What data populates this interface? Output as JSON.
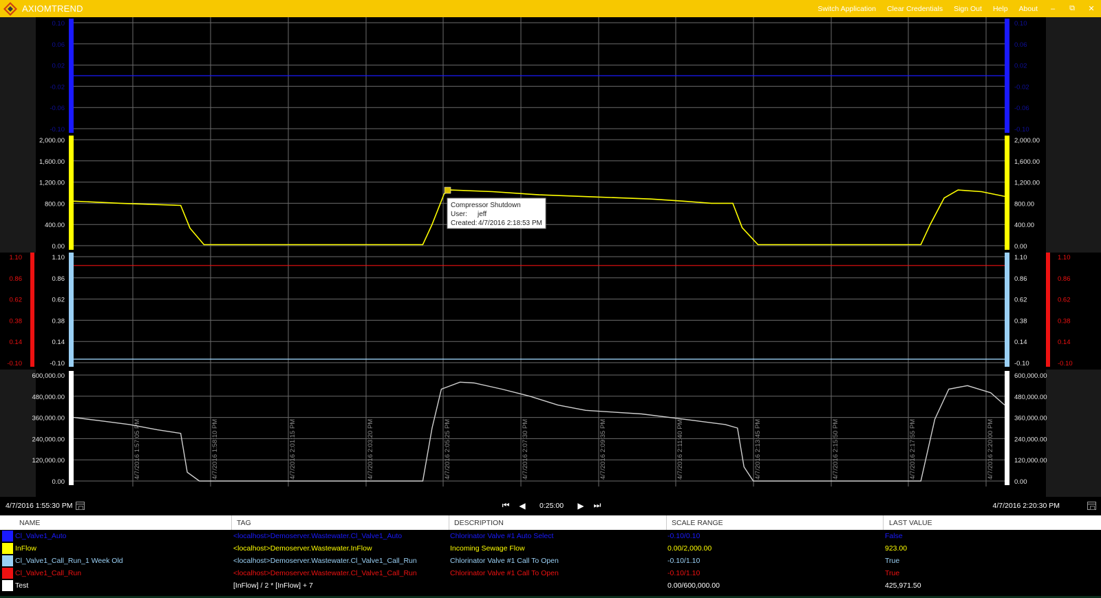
{
  "app": {
    "title": "AXIOMTREND",
    "menu": [
      "Switch Application",
      "Clear Credentials",
      "Sign Out",
      "Help",
      "About"
    ],
    "window_controls": [
      "–",
      "⧉",
      "✕"
    ]
  },
  "colors": {
    "titlebar": "#f7c800",
    "blue": "#1a1aff",
    "yellow": "#ffff00",
    "lightblue": "#9ad0f5",
    "red": "#ee1111",
    "white": "#ffffff",
    "grid": "#6b6b6b"
  },
  "chart_data": {
    "type": "line",
    "x_labels": [
      "4/7/2016 1:57:05 PM",
      "4/7/2016 1:58:10 PM",
      "4/7/2016 2:01:15 PM",
      "4/7/2016 2:03:20 PM",
      "4/7/2016 2:05:25 PM",
      "4/7/2016 2:07:30 PM",
      "4/7/2016 2:09:35 PM",
      "4/7/2016 2:11:40 PM",
      "4/7/2016 2:13:45 PM",
      "4/7/2016 2:15:50 PM",
      "4/7/2016 2:17:55 PM",
      "4/7/2016 2:20:00 PM"
    ],
    "panes": [
      {
        "name": "Cl_Valve1_Auto",
        "color": "#1a1aff",
        "left_ticks": [
          "0.10",
          "0.06",
          "0.02",
          "-0.02",
          "-0.06",
          "-0.10"
        ],
        "right_ticks": [
          "0.10",
          "0.06",
          "0.02",
          "-0.02",
          "-0.06",
          "-0.10"
        ],
        "ylim": [
          -0.1,
          0.1
        ],
        "values": [
          [
            0,
            0.0
          ],
          [
            100,
            0.0
          ]
        ]
      },
      {
        "name": "InFlow",
        "color": "#ffff00",
        "left_ticks": [
          "2,000.00",
          "1,600.00",
          "1,200.00",
          "800.00",
          "400.00",
          "0.00"
        ],
        "right_ticks": [
          "2,000.00",
          "1,600.00",
          "1,200.00",
          "800.00",
          "400.00",
          "0.00"
        ],
        "ylim": [
          0,
          2000
        ],
        "values": [
          [
            0,
            840
          ],
          [
            5,
            800
          ],
          [
            11.5,
            760
          ],
          [
            12.5,
            330
          ],
          [
            14,
            20
          ],
          [
            37.5,
            20
          ],
          [
            38.5,
            400
          ],
          [
            39.8,
            980
          ],
          [
            40.5,
            1050
          ],
          [
            45,
            1020
          ],
          [
            50,
            960
          ],
          [
            56,
            920
          ],
          [
            62,
            880
          ],
          [
            65.5,
            840
          ],
          [
            68.5,
            800
          ],
          [
            70.8,
            800
          ],
          [
            71.8,
            340
          ],
          [
            73.5,
            20
          ],
          [
            91,
            20
          ],
          [
            92,
            400
          ],
          [
            93.5,
            900
          ],
          [
            95,
            1050
          ],
          [
            97.5,
            1020
          ],
          [
            100,
            930
          ]
        ]
      },
      {
        "name": "Cl_Valve1_Call_Run",
        "color": "#ee1111",
        "left_ticks": [
          "1.10",
          "0.86",
          "0.62",
          "0.38",
          "0.14",
          "-0.10"
        ],
        "right_ticks": [
          "1.10",
          "0.86",
          "0.62",
          "0.38",
          "0.14",
          "-0.10"
        ],
        "ylim": [
          -0.1,
          1.1
        ],
        "values": [
          [
            0,
            1.0
          ],
          [
            100,
            1.0
          ]
        ]
      },
      {
        "name": "Cl_Valve1_Call_Run_1 Week Old",
        "color": "#9ad0f5",
        "left_ticks": [
          "1.10",
          "0.86",
          "0.62",
          "0.38",
          "0.14",
          "-0.10"
        ],
        "right_ticks": [
          "1.10",
          "0.86",
          "0.62",
          "0.38",
          "0.14",
          "-0.10"
        ],
        "ylim": [
          -0.1,
          1.1
        ],
        "values": [
          [
            0,
            -0.06
          ],
          [
            100,
            -0.06
          ]
        ]
      },
      {
        "name": "Test",
        "color": "#ffffff",
        "left_ticks": [
          "600,000.00",
          "480,000.00",
          "360,000.00",
          "240,000.00",
          "120,000.00",
          "0.00"
        ],
        "right_ticks": [
          "600,000.00",
          "480,000.00",
          "360,000.00",
          "240,000.00",
          "120,000.00",
          "0.00"
        ],
        "ylim": [
          0,
          600000
        ],
        "values": [
          [
            0,
            360000
          ],
          [
            3,
            340000
          ],
          [
            6,
            320000
          ],
          [
            9,
            290000
          ],
          [
            11.5,
            270000
          ],
          [
            12.2,
            50000
          ],
          [
            13.5,
            0
          ],
          [
            37.5,
            0
          ],
          [
            38.5,
            300000
          ],
          [
            39.5,
            520000
          ],
          [
            41.5,
            560000
          ],
          [
            43,
            555000
          ],
          [
            46,
            520000
          ],
          [
            49,
            480000
          ],
          [
            52,
            430000
          ],
          [
            55,
            400000
          ],
          [
            58,
            390000
          ],
          [
            61,
            380000
          ],
          [
            64,
            360000
          ],
          [
            67,
            340000
          ],
          [
            70,
            320000
          ],
          [
            71.3,
            300000
          ],
          [
            72,
            80000
          ],
          [
            73,
            0
          ],
          [
            91,
            0
          ],
          [
            92.5,
            350000
          ],
          [
            94,
            520000
          ],
          [
            96,
            540000
          ],
          [
            98.5,
            500000
          ],
          [
            100,
            430000
          ]
        ]
      }
    ],
    "annotation": {
      "title": "Compressor Shutdown",
      "user_label": "User:",
      "user": "jeff",
      "created_label": "Created:",
      "created": "4/7/2016 2:18:53 PM"
    }
  },
  "navigator": {
    "start": "4/7/2016 1:55:30 PM",
    "end": "4/7/2016 2:20:30 PM",
    "range": "0:25:00",
    "first": "⏮",
    "prev": "◀",
    "next": "▶",
    "last": "⏭"
  },
  "legend": {
    "headers": [
      "NAME",
      "TAG",
      "DESCRIPTION",
      "SCALE RANGE",
      "LAST VALUE"
    ],
    "rows": [
      {
        "color": "#1a1aff",
        "name": "Cl_Valve1_Auto",
        "tag": "<localhost>Demoserver.Wastewater.Cl_Valve1_Auto",
        "description": "Chlorinator Valve #1 Auto Select",
        "scale": "-0.10/0.10",
        "last": "False"
      },
      {
        "color": "#ffff00",
        "name": "InFlow",
        "tag": "<localhost>Demoserver.Wastewater.InFlow",
        "description": "Incoming Sewage Flow",
        "scale": "0.00/2,000.00",
        "last": "923.00"
      },
      {
        "color": "#9ad0f5",
        "name": "Cl_Valve1_Call_Run_1 Week Old",
        "tag": "<localhost>Demoserver.Wastewater.Cl_Valve1_Call_Run",
        "description": "Chlorinator Valve #1 Call To Open",
        "scale": "-0.10/1.10",
        "last": "True"
      },
      {
        "color": "#ee1111",
        "name": "Cl_Valve1_Call_Run",
        "tag": "<localhost>Demoserver.Wastewater.Cl_Valve1_Call_Run",
        "description": "Chlorinator Valve #1 Call To Open",
        "scale": "-0.10/1.10",
        "last": "True"
      },
      {
        "color": "#ffffff",
        "name": "Test",
        "tag": "[InFlow] / 2  * [InFlow] + 7",
        "description": "",
        "scale": "0.00/600,000.00",
        "last": "425,971.50"
      }
    ]
  }
}
